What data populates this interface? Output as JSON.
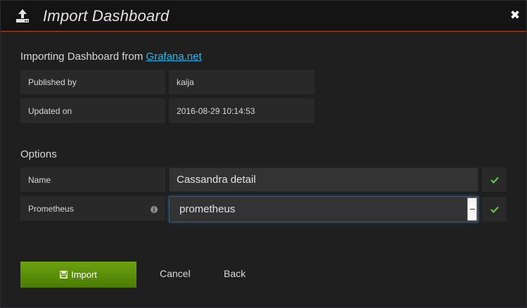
{
  "header": {
    "title": "Import Dashboard",
    "icon": "upload-icon",
    "close_icon": "close-icon"
  },
  "source": {
    "prefix": "Importing Dashboard from ",
    "link_text": "Grafana.net"
  },
  "meta": [
    {
      "label": "Published by",
      "value": "kaija"
    },
    {
      "label": "Updated on",
      "value": "2016-08-29 10:14:53"
    }
  ],
  "options": {
    "title": "Options",
    "name_label": "Name",
    "name_value": "Cassandra detail",
    "prometheus_label": "Prometheus",
    "prometheus_value": "prometheus",
    "info_icon": "info-icon",
    "check_icon": "check-icon"
  },
  "actions": {
    "import_label": "Import",
    "cancel_label": "Cancel",
    "back_label": "Back"
  },
  "colors": {
    "accent_border": "#b2471a",
    "link": "#33b5e5",
    "success": "#5ecc3f",
    "import_button": "#5c9010"
  }
}
